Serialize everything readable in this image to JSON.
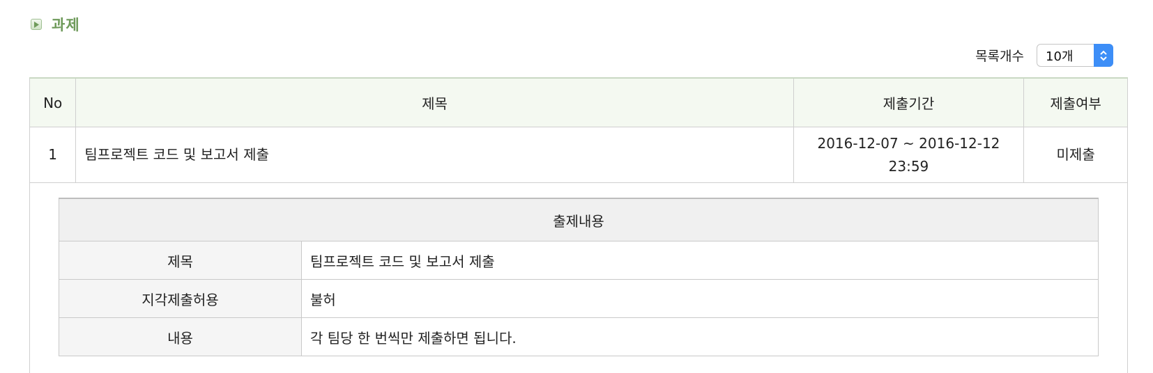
{
  "section": {
    "title": "과제",
    "icon": "play-icon",
    "title_color": "#6e9a5a"
  },
  "list_count": {
    "label": "목록개수",
    "selected": "10개",
    "arrow_color": "#3d8ef7"
  },
  "table": {
    "headers": [
      "No",
      "제목",
      "제출기간",
      "제출여부"
    ],
    "rows": [
      {
        "no": "1",
        "title": "팀프로젝트 코드 및 보고서 제출",
        "period_start": "2016-12-07 ~ 2016-12-12",
        "period_end": "23:59",
        "status": "미제출"
      }
    ]
  },
  "detail": {
    "heading": "출제내용",
    "fields": [
      {
        "label": "제목",
        "value": "팀프로젝트 코드 및 보고서 제출"
      },
      {
        "label": "지각제출허용",
        "value": "불허"
      },
      {
        "label": "내용",
        "value": "각 팀당 한 번씩만 제출하면 됩니다."
      }
    ]
  }
}
